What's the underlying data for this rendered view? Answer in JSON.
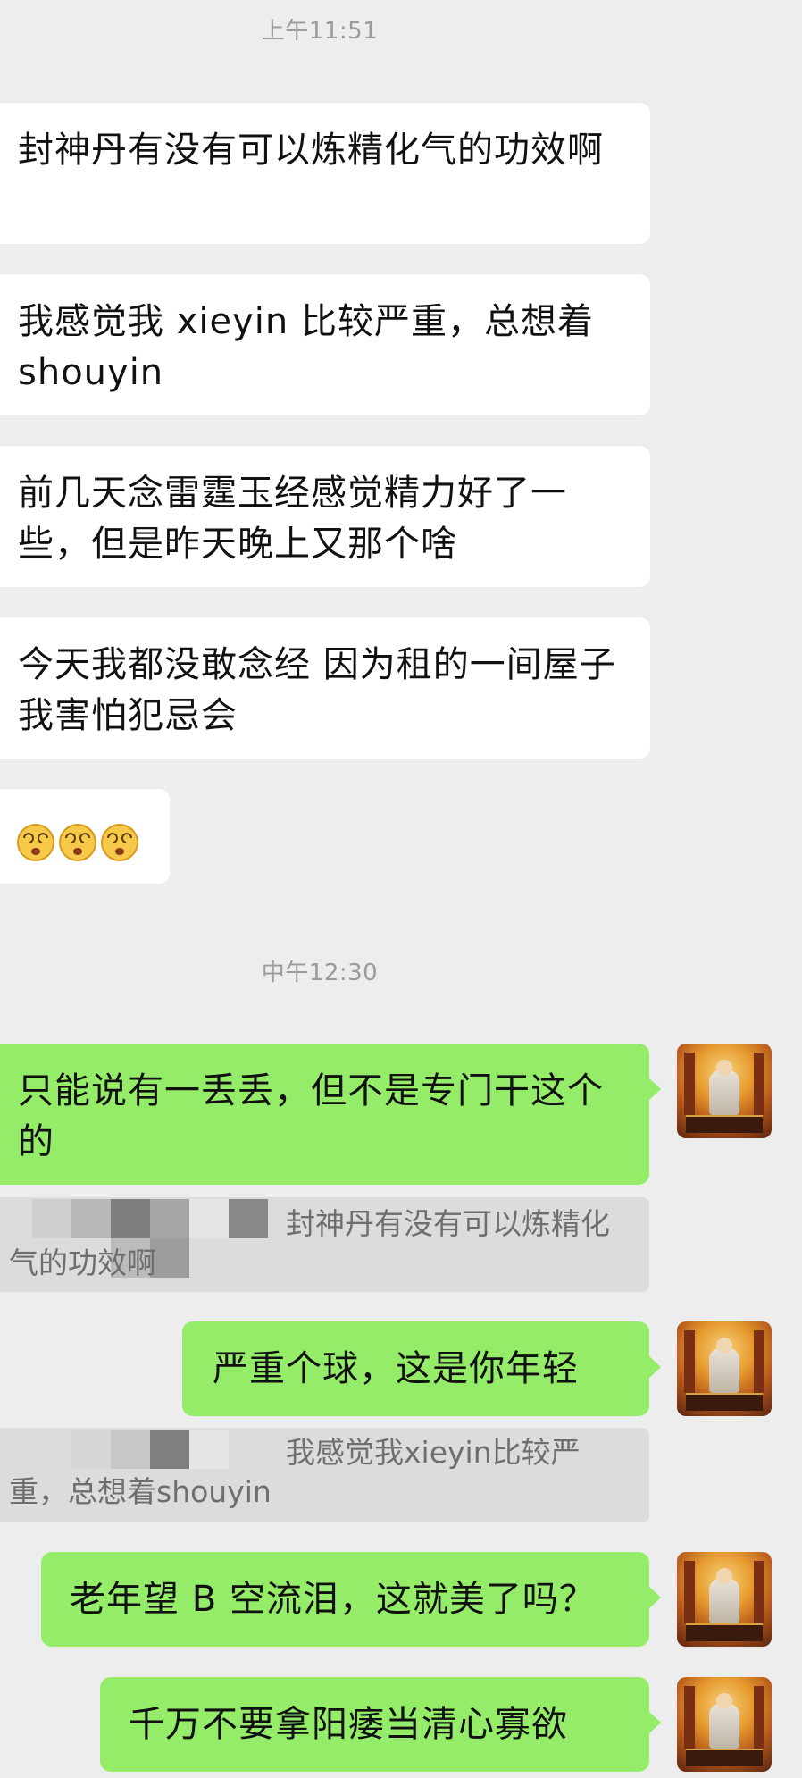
{
  "timestamps": {
    "first": "上午11:51",
    "second": "中午12:30"
  },
  "incoming": [
    {
      "text": "封神丹有没有可以炼精化气的功效啊"
    },
    {
      "text": "我感觉我 xieyin 比较严重，总想着 shouyin"
    },
    {
      "text": "前几天念雷霆玉经感觉精力好了一些，但是昨天晚上又那个啥"
    },
    {
      "text": "今天我都没敢念经 因为租的一间屋子我害怕犯忌会"
    },
    {
      "emojis": [
        "dizzy-face-emoji",
        "dizzy-face-emoji",
        "dizzy-face-emoji"
      ]
    }
  ],
  "outgoing": [
    {
      "text": "只能说有一丢丢，但不是专门干这个的",
      "quote": "封神丹有没有可以炼精化气的功效啊"
    },
    {
      "text": "严重个球，这是你年轻",
      "quote": "我感觉我xieyin比较严重，总想着shouyin"
    },
    {
      "text": "老年望 B 空流泪，这就美了吗？"
    },
    {
      "text": "千万不要拿阳痿当清心寡欲"
    }
  ],
  "colors": {
    "background": "#ededed",
    "incoming_bubble": "#ffffff",
    "outgoing_bubble": "#95ec69",
    "quote_bg": "#dcdcdc"
  }
}
